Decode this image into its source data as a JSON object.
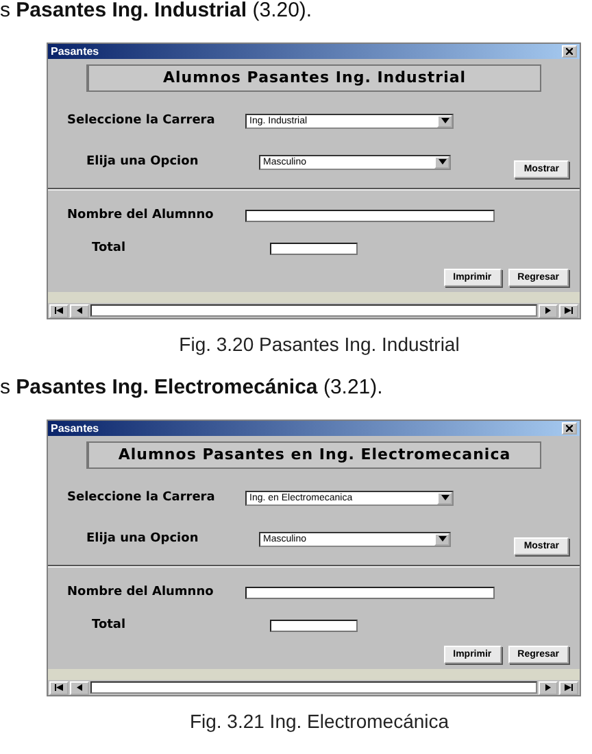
{
  "sections": [
    {
      "intro": "s **Pasantes Ing. Industrial** (3.20).",
      "window": {
        "title": "Pasantes",
        "heading": "Alumnos Pasantes Ing. Industrial",
        "carrera_label": "Seleccione la Carrera",
        "carrera_value": "Ing. Industrial",
        "opcion_label": "Elija una Opcion",
        "opcion_value": "Masculino",
        "show_button": "Mostrar",
        "name_label": "Nombre del Alumnno",
        "total_label": "Total",
        "buttons": [
          "Imprimir",
          "Regresar"
        ]
      },
      "caption": "Fig. 3.20 Pasantes Ing. Industrial"
    },
    {
      "intro": "s **Pasantes Ing. Electromecánica** (3.21).",
      "window": {
        "title": "Pasantes",
        "heading": "Alumnos Pasantes en Ing. Electromecanica",
        "carrera_label": "Seleccione  la Carrera",
        "carrera_value": "Ing. en Electromecanica",
        "opcion_label": "Elija una Opcion",
        "opcion_value": "Masculino",
        "show_button": "Mostrar",
        "name_label": "Nombre del Alumnno",
        "total_label": "Total",
        "buttons": [
          "Imprimir",
          "Regresar"
        ]
      },
      "caption": "Fig. 3.21 Ing. Electromecánica"
    }
  ]
}
